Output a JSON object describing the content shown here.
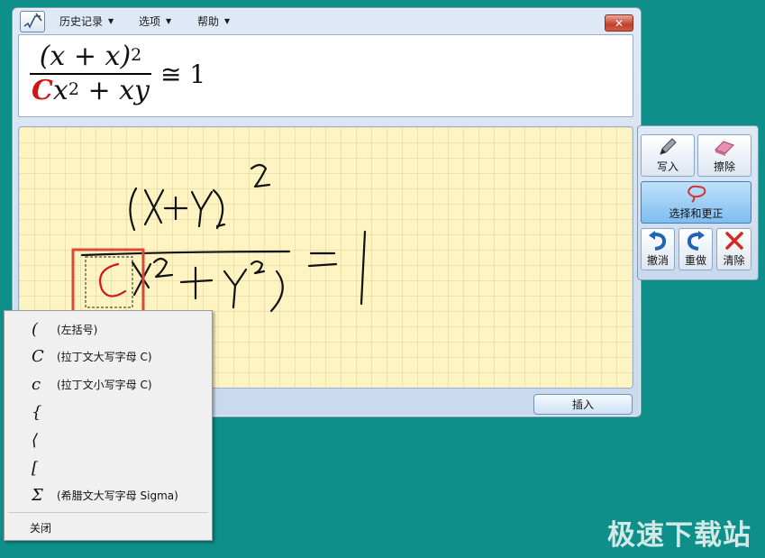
{
  "menubar": {
    "history": "历史记录",
    "options": "选项",
    "help": "帮助",
    "close_glyph": "✕"
  },
  "preview": {
    "numerator": "(x + x)",
    "num_exp": "2",
    "red_letter": "C",
    "den_rest": "x",
    "den_exp": "2",
    "den_tail": " + xy",
    "relation": "≅ 1"
  },
  "insert_label": "插入",
  "tools": {
    "write": "写入",
    "erase": "擦除",
    "select_correct": "选择和更正",
    "undo": "撤消",
    "redo": "重做",
    "clear": "清除"
  },
  "context_menu": {
    "items": [
      {
        "symbol": "(",
        "desc": "(左括号)"
      },
      {
        "symbol": "C",
        "desc": "(拉丁文大写字母 C)"
      },
      {
        "symbol": "c",
        "desc": "(拉丁文小写字母 C)"
      },
      {
        "symbol": "{",
        "desc": ""
      },
      {
        "symbol": "⟨",
        "desc": ""
      },
      {
        "symbol": "[",
        "desc": ""
      },
      {
        "symbol": "Σ",
        "desc": "(希腊文大写字母 Sigma)"
      }
    ],
    "close": "关闭"
  },
  "watermark": "极速下载站",
  "colors": {
    "desktop": "#0f8f89",
    "ink": "#111111",
    "selection": "#d84a3a",
    "highlight_letter": "#d21414",
    "writing_bg": "#fdf4c2"
  }
}
